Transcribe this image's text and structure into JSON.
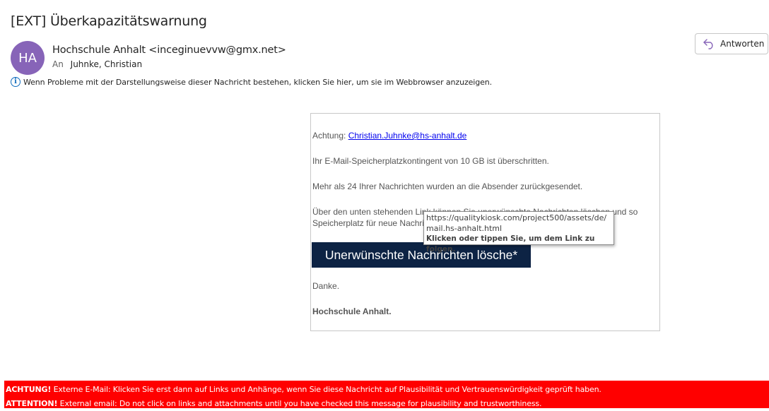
{
  "email": {
    "subject": "[EXT] Überkapazitätswarnung",
    "avatar_initials": "HA",
    "avatar_color": "#8764b8",
    "sender": "Hochschule Anhalt <inceginuevvw@gmx.net>",
    "to_label": "An",
    "to_name": "Juhnke, Christian",
    "reply_label": "Antworten",
    "info_text": "Wenn Probleme mit der Darstellungsweise dieser Nachricht bestehen, klicken Sie hier, um sie im Webbrowser anzuzeigen."
  },
  "body": {
    "greeting_label": "Achtung: ",
    "greeting_email": "Christian.Juhnke@hs-anhalt.de",
    "line1": "Ihr E-Mail-Speicherplatzkontingent von 10 GB ist überschritten.",
    "line2": "Mehr als 24 Ihrer Nachrichten wurden an die Absender zurückgesendet.",
    "line3a": "Über den unten stehenden Link können Sie unerwünschte Nachrichten löschen und so",
    "line3b": "Speicherplatz für neue Nachrichten schaffen.",
    "cta_label": "Unerwünschte Nachrichten lösche*",
    "thanks": "Danke.",
    "signature": "Hochschule Anhalt.",
    "cta_color": "#0d2344"
  },
  "tooltip": {
    "url_line1": "https://qualitykiosk.com/project500/assets/de/",
    "url_line2": "mail.hs-anhalt.html",
    "action": "Klicken oder tippen Sie, um dem Link zu folgen."
  },
  "banner": {
    "color": "#ff0000",
    "de_bold": "ACHTUNG!",
    "de_text": " Externe E-Mail: Klicken Sie erst dann auf Links und Anhänge, wenn Sie diese Nachricht auf Plausibilität und Vertrauenswürdigkeit geprüft haben.",
    "en_bold": "ATTENTION!",
    "en_text": " External email: Do not click on links and attachments until you have checked this message for plausibility and trustworthiness."
  }
}
